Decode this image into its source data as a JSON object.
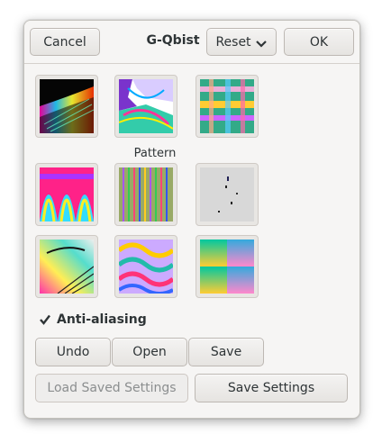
{
  "header": {
    "title": "G-Qbist",
    "cancel_label": "Cancel",
    "reset_label": "Reset",
    "ok_label": "OK"
  },
  "pattern_label": "Pattern",
  "options": {
    "antialiasing_label": "Anti-aliasing",
    "antialiasing_checked": true
  },
  "actions": {
    "undo_label": "Undo",
    "open_label": "Open",
    "save_label": "Save",
    "load_saved_label": "Load Saved Settings",
    "save_settings_label": "Save Settings"
  },
  "thumbnails": [
    "pattern-1",
    "pattern-2",
    "pattern-3",
    "pattern-4",
    "pattern-5",
    "pattern-6",
    "pattern-7",
    "pattern-8",
    "pattern-9"
  ]
}
